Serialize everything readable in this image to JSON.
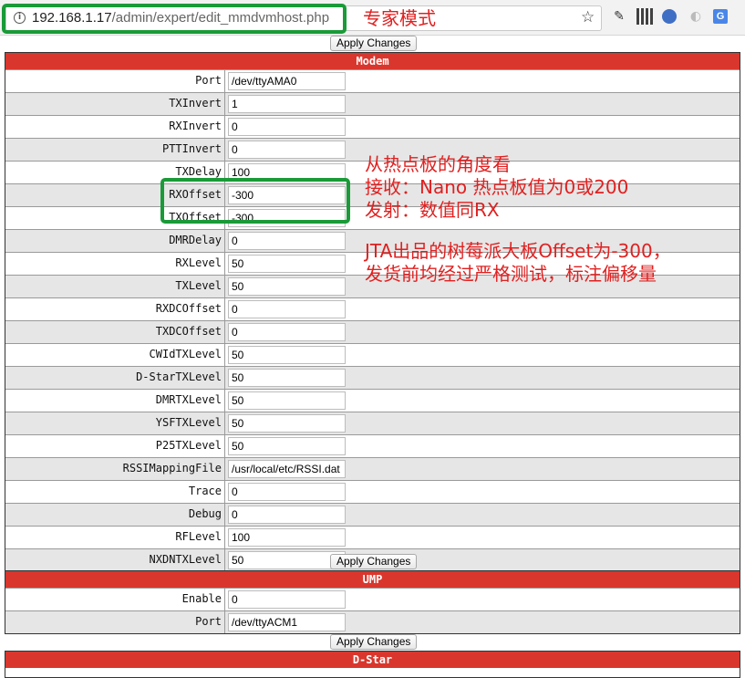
{
  "browser": {
    "url_host": "192.168.1.17",
    "url_path": "/admin/expert/edit_mmdvmhost.php"
  },
  "annotations": {
    "title": "专家模式",
    "notes": [
      "从热点板的角度看",
      "接收：Nano 热点板值为0或200",
      "发射：数值同RX",
      "JTA出品的树莓派大板Offset为-300，",
      "发货前均经过严格测试，标注偏移量"
    ],
    "highlight_color": "#1a9a38",
    "text_color": "#e02020"
  },
  "apply_label": "Apply Changes",
  "sections": {
    "modem": {
      "title": "Modem",
      "rows": [
        {
          "label": "Port",
          "value": "/dev/ttyAMA0"
        },
        {
          "label": "TXInvert",
          "value": "1"
        },
        {
          "label": "RXInvert",
          "value": "0"
        },
        {
          "label": "PTTInvert",
          "value": "0"
        },
        {
          "label": "TXDelay",
          "value": "100"
        },
        {
          "label": "RXOffset",
          "value": "-300"
        },
        {
          "label": "TXOffset",
          "value": "-300"
        },
        {
          "label": "DMRDelay",
          "value": "0"
        },
        {
          "label": "RXLevel",
          "value": "50"
        },
        {
          "label": "TXLevel",
          "value": "50"
        },
        {
          "label": "RXDCOffset",
          "value": "0"
        },
        {
          "label": "TXDCOffset",
          "value": "0"
        },
        {
          "label": "CWIdTXLevel",
          "value": "50"
        },
        {
          "label": "D-StarTXLevel",
          "value": "50"
        },
        {
          "label": "DMRTXLevel",
          "value": "50"
        },
        {
          "label": "YSFTXLevel",
          "value": "50"
        },
        {
          "label": "P25TXLevel",
          "value": "50"
        },
        {
          "label": "RSSIMappingFile",
          "value": "/usr/local/etc/RSSI.dat"
        },
        {
          "label": "Trace",
          "value": "0"
        },
        {
          "label": "Debug",
          "value": "0"
        },
        {
          "label": "RFLevel",
          "value": "100"
        },
        {
          "label": "NXDNTXLevel",
          "value": "50"
        }
      ]
    },
    "ump": {
      "title": "UMP",
      "rows": [
        {
          "label": "Enable",
          "value": "0"
        },
        {
          "label": "Port",
          "value": "/dev/ttyACM1"
        }
      ]
    },
    "dstar": {
      "title": "D-Star"
    }
  },
  "colors": {
    "section_header": "#d9372d",
    "row_alt": "#e6e6e6"
  }
}
